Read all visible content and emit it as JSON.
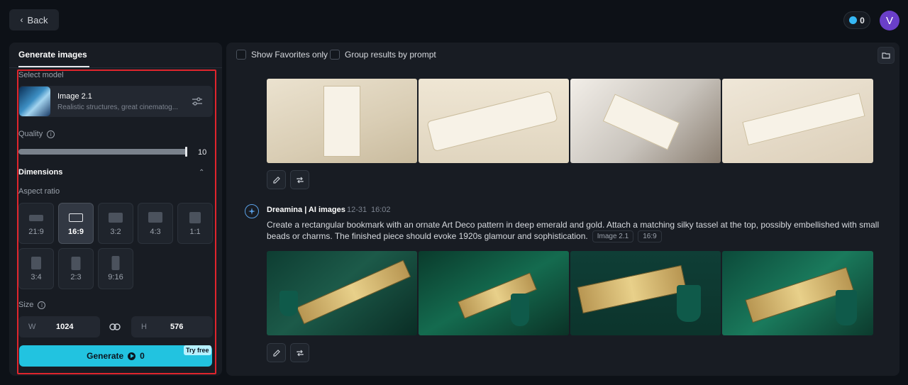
{
  "header": {
    "back_label": "Back",
    "credits": "0",
    "avatar_initial": "V"
  },
  "left_panel": {
    "tab_label": "Generate images",
    "select_model_label": "Select model",
    "model": {
      "name": "Image 2.1",
      "description": "Realistic structures, great cinematog..."
    },
    "quality_label": "Quality",
    "quality_value": "10",
    "quality_fraction": 1.0,
    "dimensions_label": "Dimensions",
    "aspect_ratio_label": "Aspect ratio",
    "aspect_ratios": [
      "21:9",
      "16:9",
      "3:2",
      "4:3",
      "1:1",
      "3:4",
      "2:3",
      "9:16"
    ],
    "selected_ratio": "16:9",
    "size_label": "Size",
    "width_letter": "W",
    "width_value": "1024",
    "height_letter": "H",
    "height_value": "576",
    "generate_label": "Generate",
    "generate_cost": "0",
    "try_free_label": "Try free"
  },
  "right_panel": {
    "show_favorites_label": "Show Favorites only",
    "group_results_label": "Group results by prompt",
    "result": {
      "author": "Dreamina | AI images",
      "date": "12-31",
      "time": "16:02",
      "prompt": "Create a rectangular bookmark with an ornate Art Deco pattern in deep emerald and gold. Attach a matching silky tassel at the top, possibly embellished with small beads or charms. The finished piece should evoke 1920s glamour and sophistication.",
      "model_chip": "Image 2.1",
      "ratio_chip": "16:9"
    }
  },
  "colors": {
    "accent": "#22c3e0",
    "highlight_border": "#e0252d",
    "avatar": "#6a3fc9",
    "background": "#0d1117",
    "panel": "#181c23"
  }
}
